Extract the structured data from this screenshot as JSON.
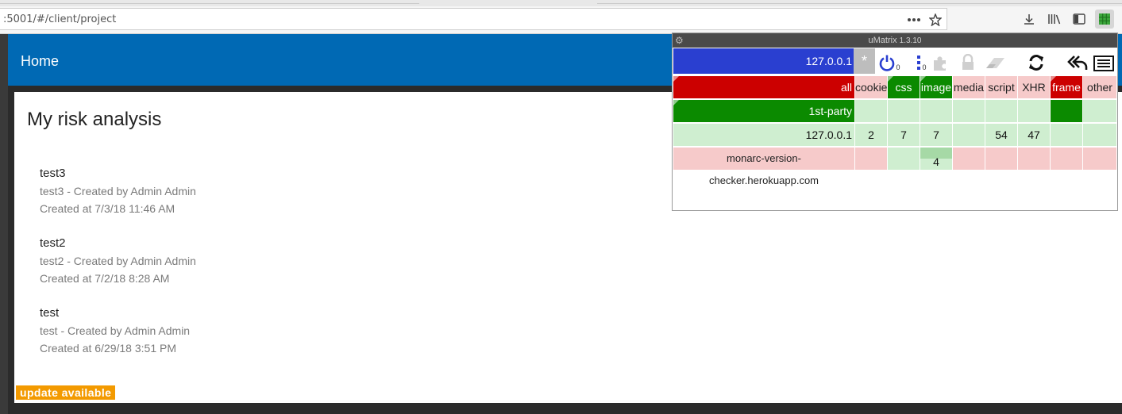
{
  "browser": {
    "url": ":5001/#/client/project",
    "icons": [
      "more-icon",
      "bookmark-star-icon",
      "download-icon",
      "library-icon",
      "sidebar-icon",
      "umatrix-icon"
    ]
  },
  "app": {
    "title": "Home",
    "card_title": "My risk analysis",
    "analyses": [
      {
        "name": "test3",
        "description": "test3 - Created by Admin Admin",
        "created": "Created at 7/3/18 11:46 AM"
      },
      {
        "name": "test2",
        "description": "test2 - Created by Admin Admin",
        "created": "Created at 7/2/18 8:28 AM"
      },
      {
        "name": "test",
        "description": "test - Created by Admin Admin",
        "created": "Created at 6/29/18 3:51 PM"
      }
    ],
    "update_badge": "update available"
  },
  "umatrix": {
    "title": "uMatrix",
    "version": "1.3.10",
    "scope": "127.0.0.1",
    "scope_wildcard": "*",
    "power_count": "0",
    "info_count": "0",
    "columns": [
      "all",
      "cookie",
      "css",
      "image",
      "media",
      "script",
      "XHR",
      "frame",
      "other"
    ],
    "rows": [
      {
        "label": "1st-party",
        "values": [
          "",
          "",
          "",
          "",
          "",
          "",
          "",
          ""
        ]
      },
      {
        "label": "127.0.0.1",
        "values": [
          "2",
          "7",
          "7",
          "",
          "54",
          "47",
          "",
          ""
        ]
      },
      {
        "label": "monarc-version-checker.herokuapp.com",
        "values": [
          "",
          "",
          "4",
          "",
          "",
          "",
          "",
          ""
        ]
      }
    ],
    "colors": {
      "blocked": "#cc0000",
      "allowed": "#0b8a00",
      "scope": "#2a3fd0"
    }
  }
}
